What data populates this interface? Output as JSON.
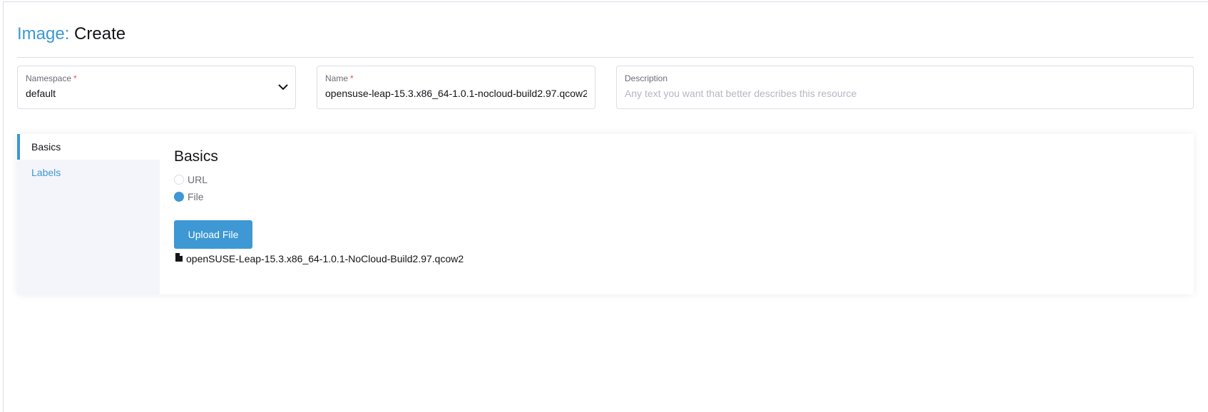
{
  "header": {
    "title_resource": "Image:",
    "title_verb": "Create"
  },
  "form": {
    "namespace": {
      "label": "Namespace",
      "required_mark": "*",
      "value": "default"
    },
    "name": {
      "label": "Name",
      "required_mark": "*",
      "value": "opensuse-leap-15.3.x86_64-1.0.1-nocloud-build2.97.qcow2"
    },
    "description": {
      "label": "Description",
      "placeholder": "Any text you want that better describes this resource"
    }
  },
  "tabs": [
    {
      "label": "Basics",
      "active": true
    },
    {
      "label": "Labels",
      "active": false
    }
  ],
  "basics": {
    "section_title": "Basics",
    "source_options": [
      {
        "label": "URL",
        "checked": false
      },
      {
        "label": "File",
        "checked": true
      }
    ],
    "upload_button_label": "Upload File",
    "file_icon": "file-icon",
    "selected_file_name": "openSUSE-Leap-15.3.x86_64-1.0.1-NoCloud-Build2.97.qcow2"
  },
  "colors": {
    "accent": "#3d98d3",
    "required": "#f64747",
    "border": "#dcdee7",
    "tab_background": "#f4f5fa"
  }
}
